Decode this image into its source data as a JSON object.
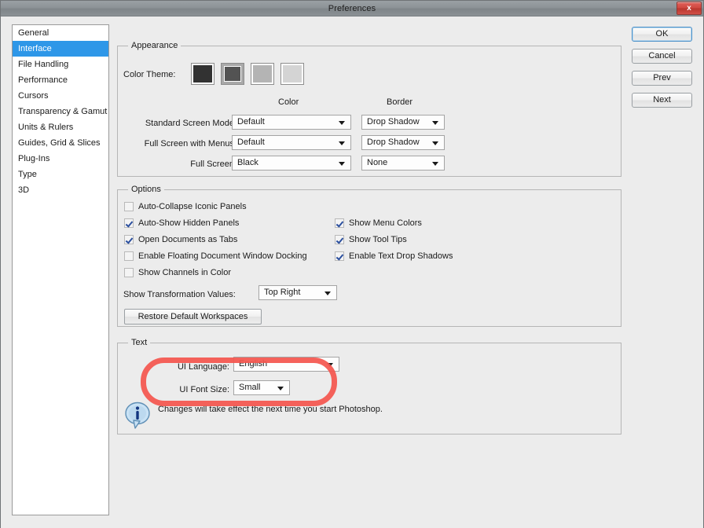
{
  "window": {
    "title": "Preferences",
    "close_label": "x"
  },
  "sidebar": {
    "items": [
      {
        "label": "General",
        "selected": false
      },
      {
        "label": "Interface",
        "selected": true
      },
      {
        "label": "File Handling",
        "selected": false
      },
      {
        "label": "Performance",
        "selected": false
      },
      {
        "label": "Cursors",
        "selected": false
      },
      {
        "label": "Transparency & Gamut",
        "selected": false
      },
      {
        "label": "Units & Rulers",
        "selected": false
      },
      {
        "label": "Guides, Grid & Slices",
        "selected": false
      },
      {
        "label": "Plug-Ins",
        "selected": false
      },
      {
        "label": "Type",
        "selected": false
      },
      {
        "label": "3D",
        "selected": false
      }
    ]
  },
  "buttons": {
    "ok": "OK",
    "cancel": "Cancel",
    "prev": "Prev",
    "next": "Next"
  },
  "appearance": {
    "group_title": "Appearance",
    "color_theme_label": "Color Theme:",
    "swatches": [
      {
        "color": "#323232",
        "selected": false
      },
      {
        "color": "#535353",
        "selected": true
      },
      {
        "color": "#b4b4b4",
        "selected": false
      },
      {
        "color": "#d4d4d4",
        "selected": false
      }
    ],
    "column_color": "Color",
    "column_border": "Border",
    "rows": [
      {
        "label": "Standard Screen Mode:",
        "color": "Default",
        "border": "Drop Shadow"
      },
      {
        "label": "Full Screen with Menus:",
        "color": "Default",
        "border": "Drop Shadow"
      },
      {
        "label": "Full Screen:",
        "color": "Black",
        "border": "None"
      }
    ]
  },
  "options": {
    "group_title": "Options",
    "left_checkboxes": [
      {
        "label": "Auto-Collapse Iconic Panels",
        "checked": false
      },
      {
        "label": "Auto-Show Hidden Panels",
        "checked": true
      },
      {
        "label": "Open Documents as Tabs",
        "checked": true
      },
      {
        "label": "Enable Floating Document Window Docking",
        "checked": false
      },
      {
        "label": "Show Channels in Color",
        "checked": false
      }
    ],
    "right_checkboxes": [
      {
        "label": "Show Menu Colors",
        "checked": true
      },
      {
        "label": "Show Tool Tips",
        "checked": true
      },
      {
        "label": "Enable Text Drop Shadows",
        "checked": true
      }
    ],
    "transform_label": "Show Transformation Values:",
    "transform_value": "Top Right",
    "restore_button": "Restore Default Workspaces"
  },
  "text_section": {
    "group_title": "Text",
    "ui_language_label": "UI Language:",
    "ui_language_value": "English",
    "ui_font_size_label": "UI Font Size:",
    "ui_font_size_value": "Small",
    "note": "Changes will take effect the next time you start Photoshop."
  },
  "annotation": {
    "highlight_color": "#f4564f"
  }
}
